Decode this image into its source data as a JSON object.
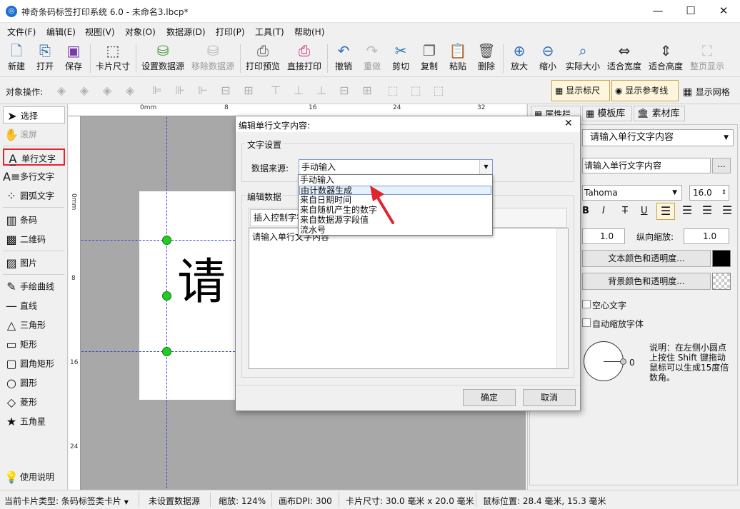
{
  "window": {
    "title": "神奇条码标签打印系统 6.0 - 未命名3.lbcp*",
    "minimize_glyph": "—",
    "maximize_glyph": "☐",
    "close_glyph": "✕"
  },
  "menu": [
    "文件(F)",
    "编辑(E)",
    "视图(V)",
    "对象(O)",
    "数据源(D)",
    "打印(P)",
    "工具(T)",
    "帮助(H)"
  ],
  "toolbar": {
    "new": "新建",
    "open": "打开",
    "save": "保存",
    "card_size": "卡片尺寸",
    "set_datasource": "设置数据源",
    "remove_datasource": "移除数据源",
    "print_preview": "打印预览",
    "direct_print": "直接打印",
    "undo": "撤销",
    "redo": "重做",
    "cut": "剪切",
    "copy": "复制",
    "paste": "粘贴",
    "delete": "删除",
    "zoom_in": "放大",
    "zoom_out": "缩小",
    "actual_size": "实际大小",
    "fit_width": "适合宽度",
    "fit_height": "适合高度",
    "page_display": "整页显示"
  },
  "opsbar": {
    "label": "对象操作:",
    "show_ruler": "显示标尺",
    "show_guides": "显示参考线",
    "show_grid": "显示网格"
  },
  "tools": {
    "select": "选择",
    "scroll": "滚屏",
    "single_text": "单行文字",
    "multi_text": "多行文字",
    "arc_text": "圆弧文字",
    "barcode": "条码",
    "qrcode": "二维码",
    "image": "图片",
    "freehand": "手绘曲线",
    "line": "直线",
    "triangle": "三角形",
    "rect": "矩形",
    "round_rect": "圆角矩形",
    "circle": "圆形",
    "diamond": "菱形",
    "star": "五角星",
    "help": "使用说明"
  },
  "rulers": {
    "top": [
      "0mm",
      "8",
      "16",
      "24",
      "32"
    ],
    "left": [
      "0mm",
      "8",
      "16",
      "24"
    ]
  },
  "canvas": {
    "label_char": "请"
  },
  "right_panel": {
    "tabs": [
      "属性栏",
      "模板库",
      "素材库"
    ],
    "object_select": "请输入单行文字内容",
    "text_value": "请输入单行文字内容",
    "ellipsis": "...",
    "font": "Tahoma",
    "font_size": "16.0",
    "style_buttons": [
      "B",
      "I",
      "T",
      "U"
    ],
    "h_scale": "1.0",
    "v_scale_label": "纵向缩放:",
    "v_scale": "1.0",
    "text_color_btn": "文本颜色和透明度...",
    "bg_color_btn": "背景颜色和透明度...",
    "hollow_text": "空心文字",
    "auto_shrink": "自动缩放字体",
    "rotation_value": "0",
    "rotation_hint": "说明：在左侧小圆点上按住 Shift 键拖动鼠标可以生成15度倍数角。",
    "colors": {
      "text": "#000000"
    }
  },
  "dialog": {
    "title": "编辑单行文字内容:",
    "close": "✕",
    "group_text_settings": "文字设置",
    "datasource_label": "数据来源:",
    "datasource_value": "手动输入",
    "dropdown_options": [
      "手动输入",
      "由计数器生成",
      "来自日期时间",
      "来自随机产生的数字",
      "来自数据源字段值",
      "流水号"
    ],
    "group_edit_data": "编辑数据",
    "insert_ctrl_btn": "插入控制字符",
    "textarea_value": "请输入单行文字内容",
    "ok": "确定",
    "cancel": "取消"
  },
  "statusbar": {
    "card_type": "当前卡片类型: 条码标签类卡片",
    "datasource": "未设置数据源",
    "zoom": "缩放: 124%",
    "dpi": "画布DPI: 300",
    "card_size": "卡片尺寸: 30.0 毫米 x 20.0 毫米",
    "mouse_pos": "鼠标位置: 28.4 毫米, 15.3 毫米"
  },
  "accent_colors": {
    "highlight_border": "#e0262d",
    "handle": "#22cc22",
    "guide": "#3344dd",
    "arrow": "#e0262d"
  }
}
